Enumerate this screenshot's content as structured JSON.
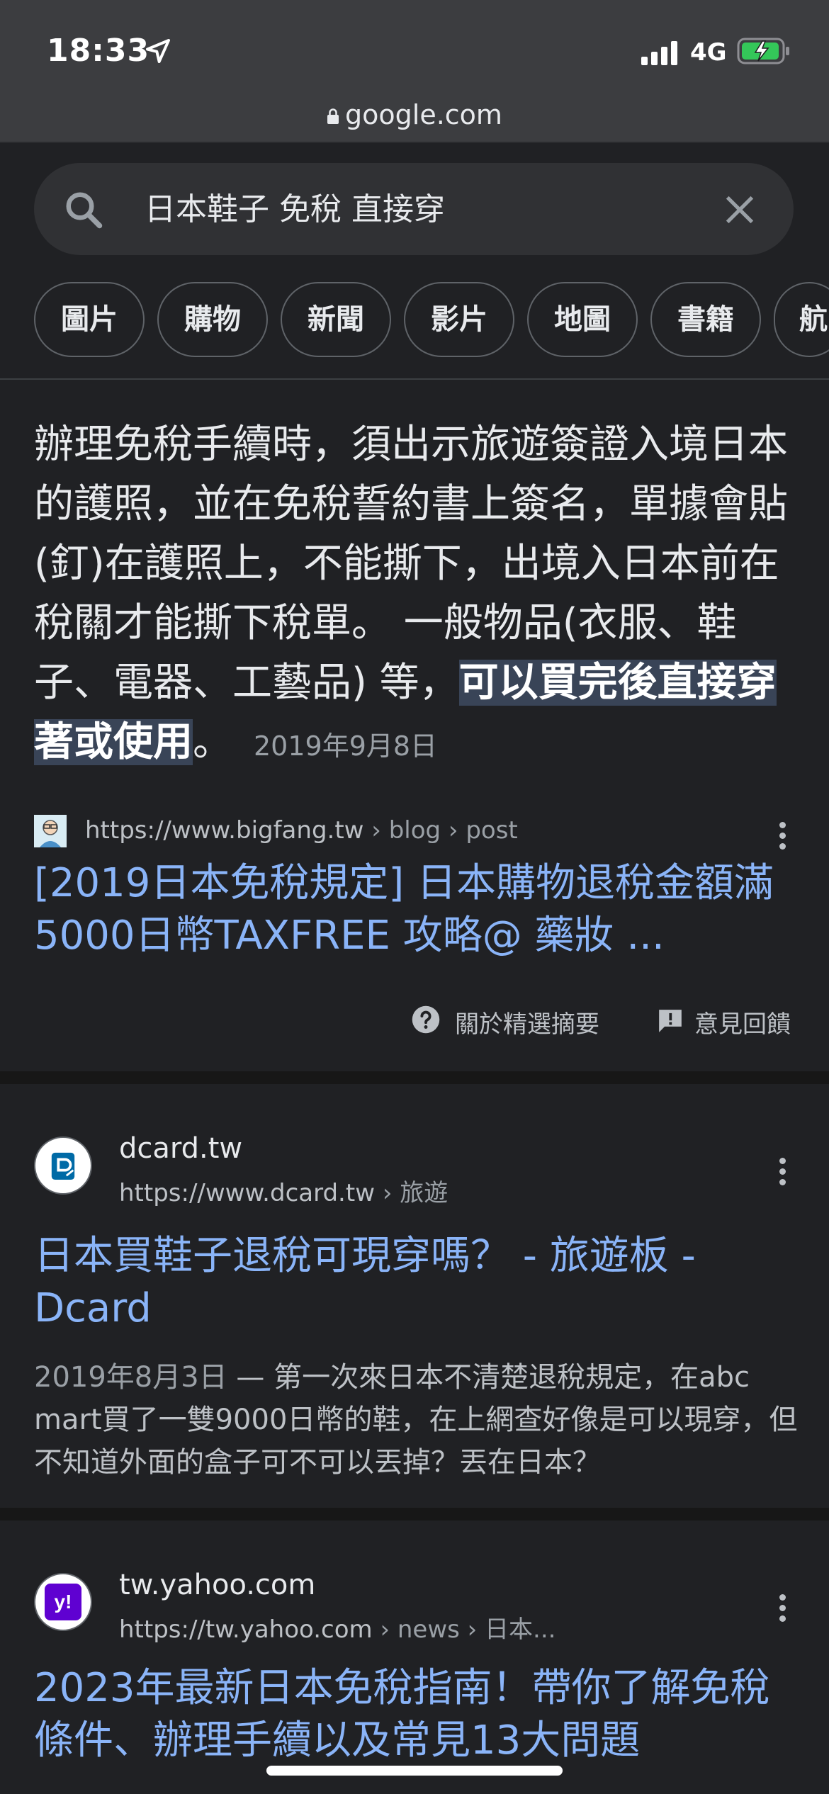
{
  "status": {
    "time": "18:33",
    "network": "4G"
  },
  "browser": {
    "url": "google.com"
  },
  "search": {
    "query": "日本鞋子 免稅 直接穿"
  },
  "chips": [
    "圖片",
    "購物",
    "新聞",
    "影片",
    "地圖",
    "書籍",
    "航"
  ],
  "snippet": {
    "text": "辦理免稅手續時，須出示旅遊簽證入境日本的護照，並在免稅誓約書上簽名，單據會貼(釘)在護照上，不能撕下，出境入日本前在稅關才能撕下稅單。 一般物品(衣服、鞋子、電器、工藝品) 等，",
    "highlight": "可以買完後直接穿著或使用",
    "end": "。",
    "date": "2019年9月8日",
    "source_url": "https://www.bigfang.tw",
    "source_path": " › blog › post",
    "title": "[2019日本免稅規定] 日本購物退稅金額滿5000日幣TAXFREE 攻略@ 藥妝 ...",
    "about_label": "關於精選摘要",
    "feedback_label": "意見回饋"
  },
  "results": [
    {
      "site": "dcard.tw",
      "url": "https://www.dcard.tw",
      "path": " › 旅遊",
      "title": "日本買鞋子退稅可現穿嗎？ - 旅遊板 - Dcard",
      "date": "2019年8月3日",
      "description": " — 第一次來日本不清楚退稅規定，在abc mart買了一雙9000日幣的鞋，在上網查好像是可以現穿，但不知道外面的盒子可不可以丟掉？丟在日本？"
    },
    {
      "site": "tw.yahoo.com",
      "url": "https://tw.yahoo.com",
      "path": " › news › 日本...",
      "title": "2023年最新日本免稅指南！帶你了解免稅條件、辦理手續以及常見13大問題",
      "favicon_text": "y!"
    }
  ],
  "colors": {
    "link": "#8ab4f8",
    "highlight_bg": "#394457",
    "yahoo": "#5f01d1",
    "dcard": "#006aa6"
  }
}
